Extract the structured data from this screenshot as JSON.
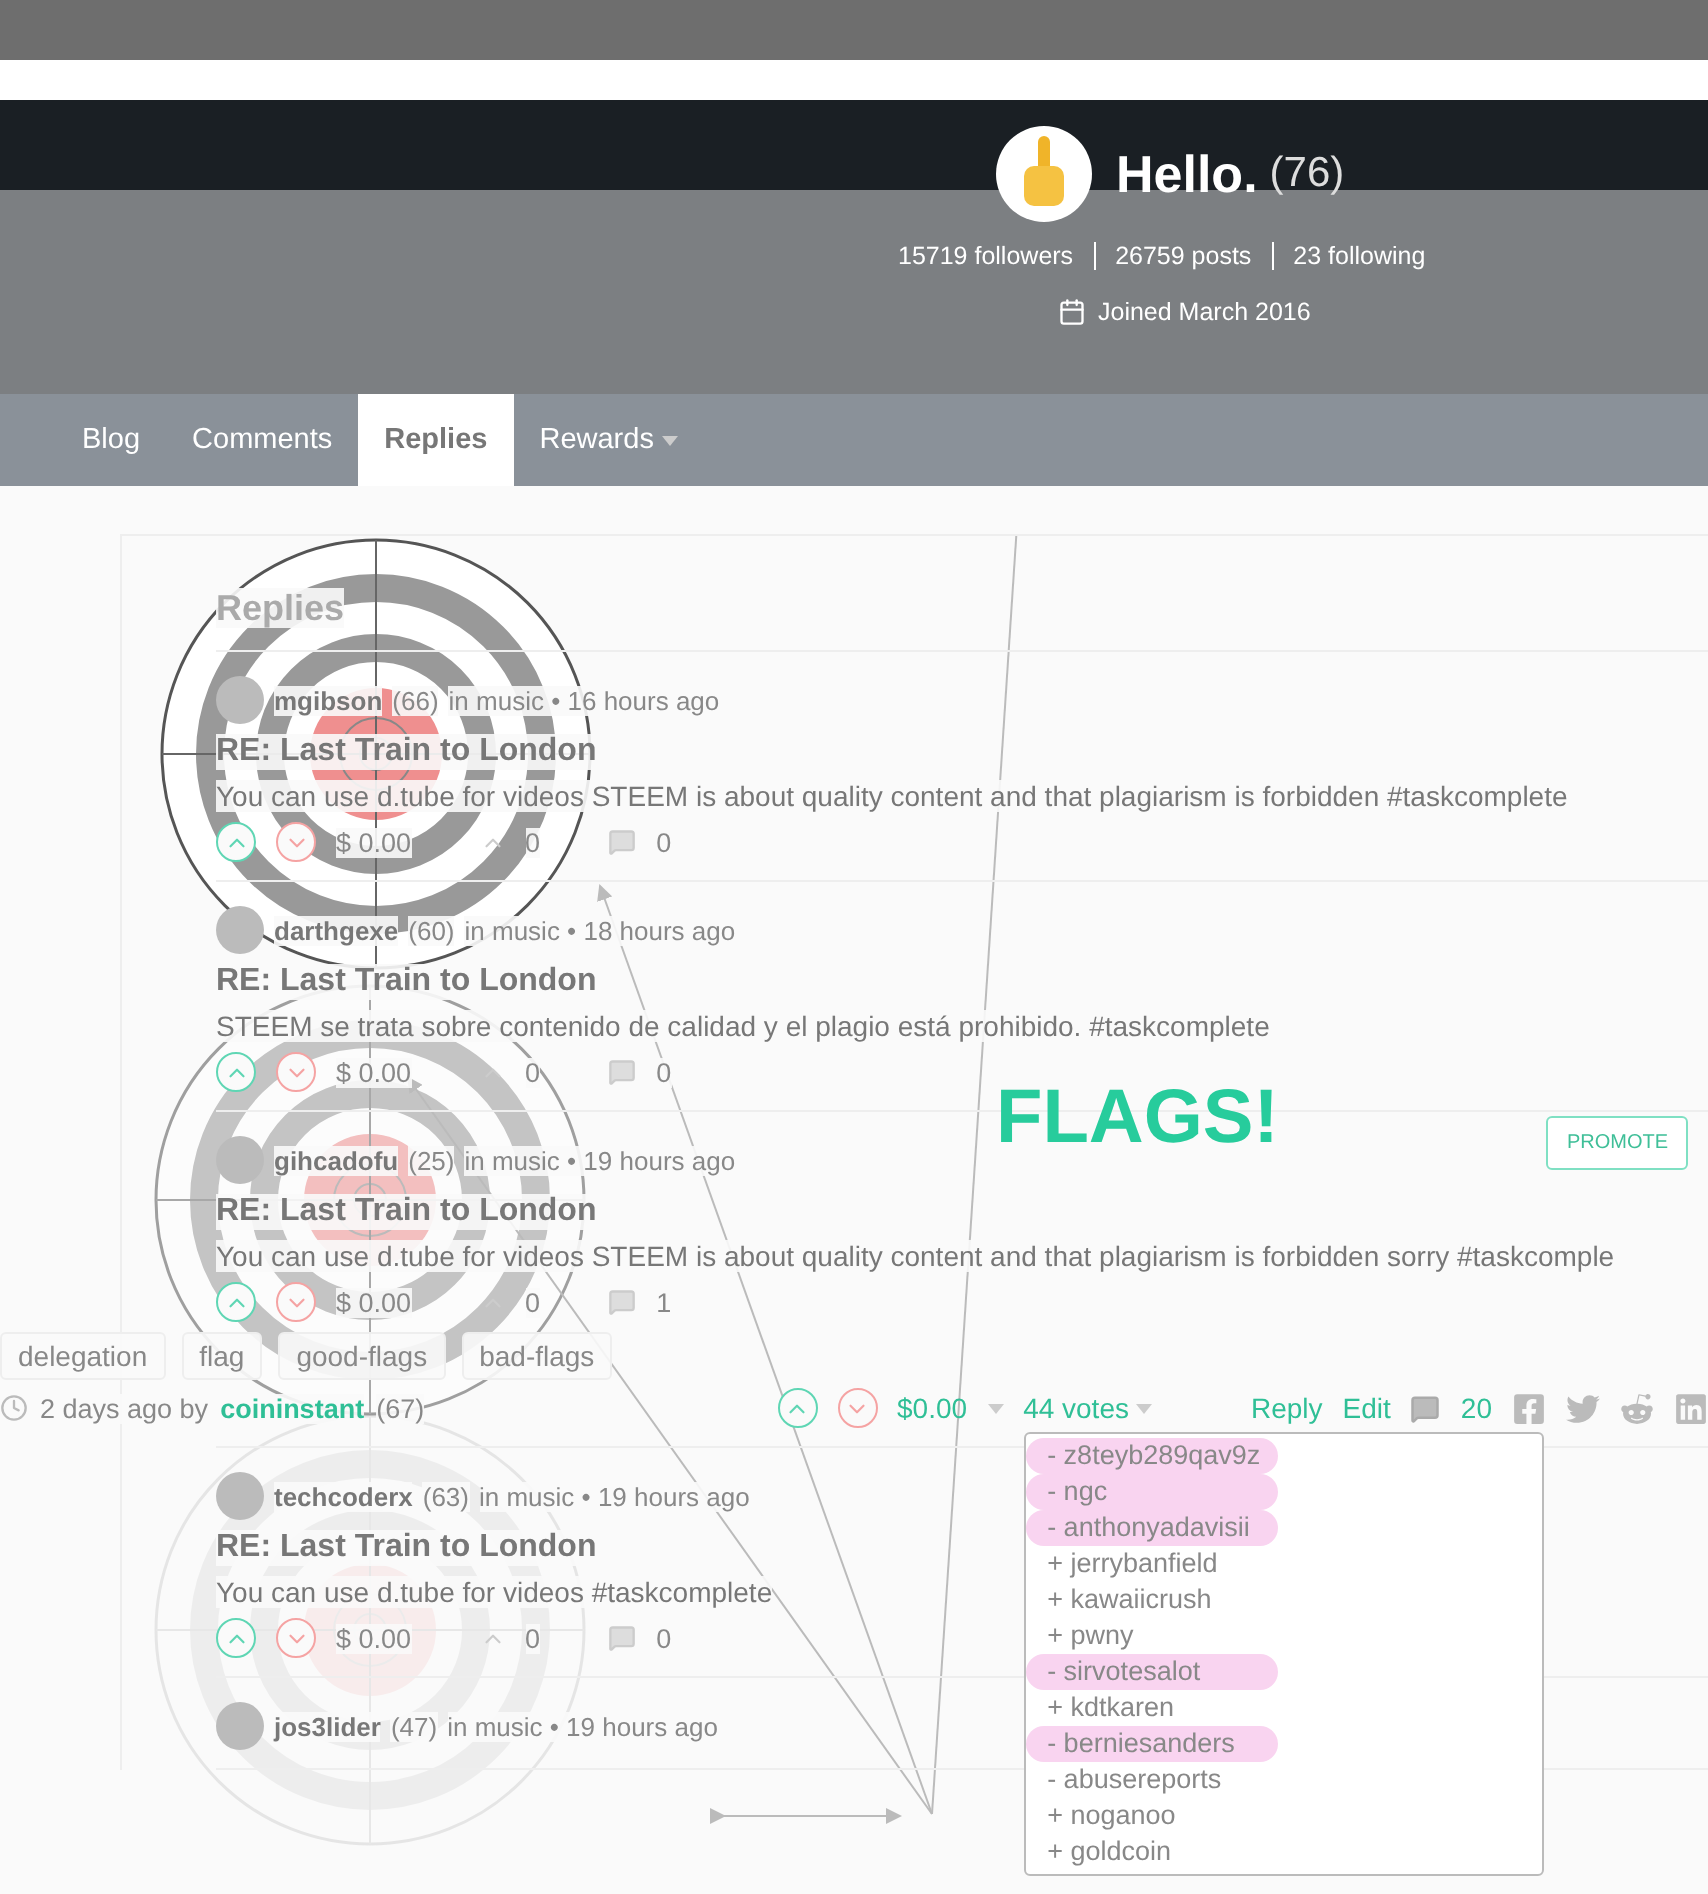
{
  "profile": {
    "name": "Hello.",
    "reputation": "(76)",
    "followers": "15719 followers",
    "posts": "26759 posts",
    "following": "23 following",
    "joined": "Joined March 2016"
  },
  "tabs": [
    {
      "label": "Blog",
      "selected": false,
      "dropdown": false
    },
    {
      "label": "Comments",
      "selected": false,
      "dropdown": false
    },
    {
      "label": "Replies",
      "selected": true,
      "dropdown": false
    },
    {
      "label": "Rewards",
      "selected": false,
      "dropdown": true
    }
  ],
  "replies_heading": "Replies",
  "replies": [
    {
      "author": "mgibson",
      "reputation": "(66)",
      "meta": "in music • 16 hours ago",
      "title": "RE: Last Train to London",
      "body": "You can use d.tube for videos STEEM is about quality content and that plagiarism is forbidden #taskcomplete",
      "payout": "$ 0.00",
      "votes": "0",
      "comments": "0"
    },
    {
      "author": "darthgexe",
      "reputation": "(60)",
      "meta": "in music • 18 hours ago",
      "title": "RE: Last Train to London",
      "body": "STEEM se trata sobre contenido de calidad y el plagio está prohibido. #taskcomplete",
      "payout": "$ 0.00",
      "votes": "0",
      "comments": "0"
    },
    {
      "author": "gihcadofu",
      "reputation": "(25)",
      "meta": "in music • 19 hours ago",
      "title": "RE: Last Train to London",
      "body": "You can use d.tube for videos STEEM is about quality content and that plagiarism is forbidden sorry #taskcomple",
      "payout": "$ 0.00",
      "votes": "0",
      "comments": "1",
      "banner": {
        "text": "FLAGS!",
        "button": "PROMOTE"
      },
      "overlay_post": {
        "tags": [
          "delegation",
          "flag",
          "good-flags",
          "bad-flags"
        ],
        "time": "2 days ago by",
        "author": "coininstant",
        "reputation": "(67)",
        "payout": "$0.00",
        "votes": "44 votes",
        "reply": "Reply",
        "edit": "Edit",
        "comments": "20",
        "voters": [
          {
            "name": "- z8teyb289qav9z",
            "flagged": true
          },
          {
            "name": "- ngc",
            "flagged": true
          },
          {
            "name": "- anthonyadavisii",
            "flagged": true
          },
          {
            "name": "+ jerrybanfield",
            "flagged": false
          },
          {
            "name": "+ kawaiicrush",
            "flagged": false
          },
          {
            "name": "+ pwny",
            "flagged": false
          },
          {
            "name": "- sirvotesalot",
            "flagged": true
          },
          {
            "name": "+ kdtkaren",
            "flagged": false
          },
          {
            "name": "- berniesanders",
            "flagged": true
          },
          {
            "name": "- abusereports",
            "flagged": false
          },
          {
            "name": "+ noganoo",
            "flagged": false
          },
          {
            "name": "+ goldcoin",
            "flagged": false
          }
        ]
      }
    },
    {
      "author": "techcoderx",
      "reputation": "(63)",
      "meta": "in music • 19 hours ago",
      "title": "RE: Last Train to London",
      "body": "You can use d.tube for videos #taskcomplete",
      "payout": "$ 0.00",
      "votes": "0",
      "comments": "0"
    },
    {
      "author": "jos3lider",
      "reputation": "(47)",
      "meta": "in music • 19 hours ago"
    }
  ]
}
